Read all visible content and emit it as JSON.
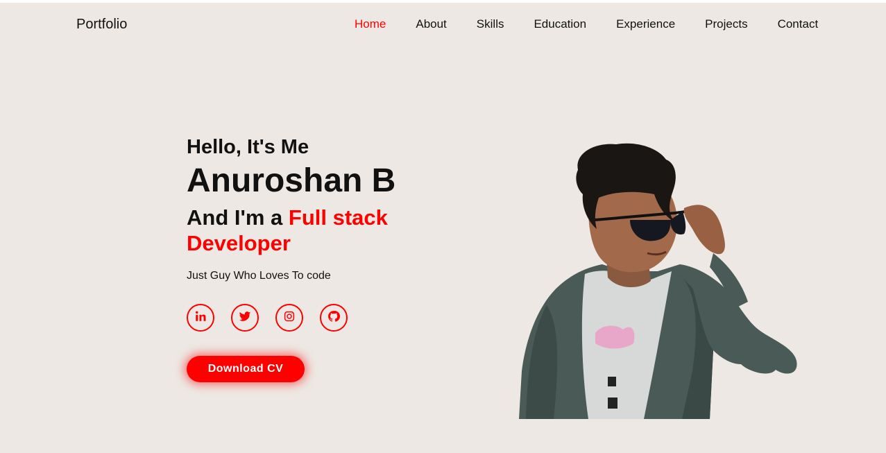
{
  "nav": {
    "logo": "Portfolio",
    "items": [
      {
        "label": "Home",
        "active": true
      },
      {
        "label": "About"
      },
      {
        "label": "Skills"
      },
      {
        "label": "Education"
      },
      {
        "label": "Experience"
      },
      {
        "label": "Projects"
      },
      {
        "label": "Contact"
      }
    ]
  },
  "hero": {
    "greeting": "Hello, It's Me",
    "name": "Anuroshan B",
    "role_prefix": "And I'm a ",
    "role_highlight": "Full stack Developer",
    "tagline": "Just Guy Who Loves To code",
    "socials": [
      {
        "icon": "linkedin-icon"
      },
      {
        "icon": "twitter-icon"
      },
      {
        "icon": "instagram-icon"
      },
      {
        "icon": "github-icon"
      }
    ],
    "cv_button": "Download CV"
  },
  "colors": {
    "accent": "#ff0000",
    "background": "#ede8e3"
  }
}
